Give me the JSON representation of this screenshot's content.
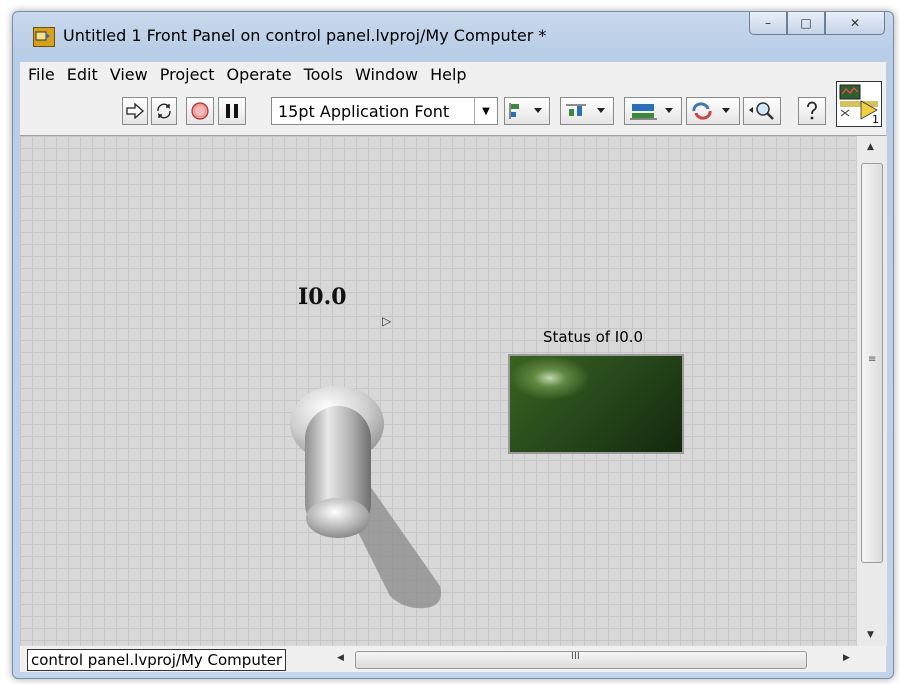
{
  "window": {
    "title": "Untitled 1 Front Panel on control panel.lvproj/My Computer *",
    "caption_buttons": [
      "–",
      "□",
      "✕"
    ]
  },
  "menu": [
    "File",
    "Edit",
    "View",
    "Project",
    "Operate",
    "Tools",
    "Window",
    "Help"
  ],
  "toolbar": {
    "font_select": "15pt Application Font",
    "vi_icon_badge": "1"
  },
  "panel": {
    "toggle_label": "I0.0",
    "led_label": "Status of I0.0"
  },
  "status": {
    "context": "control panel.lvproj/My Computer",
    "hscroll_grip": "III",
    "vscroll_grip": "≡"
  },
  "colors": {
    "led_on_dark": "#24451a",
    "panel_grid_bg": "#d8d8d8",
    "title_bar": "#b8cde6"
  }
}
